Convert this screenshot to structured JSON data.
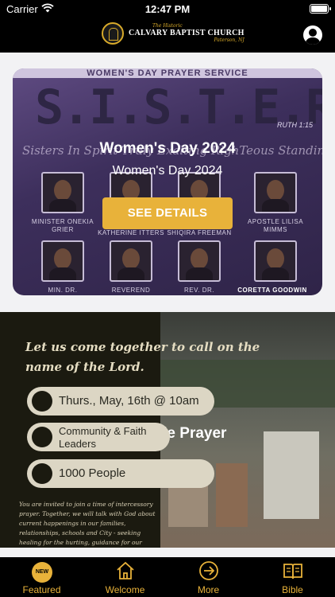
{
  "status_bar": {
    "carrier": "Carrier",
    "time": "12:47 PM"
  },
  "header": {
    "logo_small": "The Historic",
    "logo_name": "CALVARY BAPTIST CHURCH",
    "logo_location": "Paterson, NJ"
  },
  "featured_card": {
    "banner": "WOMEN'S DAY PRAYER SERVICE",
    "big_text": "S.I.S.T.E.R.S.",
    "ruth": "RUTH 1:15",
    "script": "Sisters In Spirit Truly Exalting RighTeous Standing",
    "title": "Women's Day 2024",
    "subtitle": "Women's Day 2024",
    "button_label": "SEE DETAILS",
    "names": [
      "MINISTER ONEKIA GRIER",
      "KATHERINE ITTERS",
      "SHIQIRA FREEMAN",
      "APOSTLE LILISA MIMMS",
      "MIN. DR.",
      "REVEREND",
      "REV. DR.",
      "CORETTA GOODWIN"
    ]
  },
  "prayer_card": {
    "tagline": "Let us come together to call on the name of the Lord.",
    "pill_1": "Thurs., May, 16th @ 10am",
    "pill_2": "Community & Faith Leaders",
    "pill_3": "1000 People",
    "invite": "You are invited to join a time of intercessory prayer. Together, we will talk with God about current happenings in our families, relationships, schools and City - seeking healing for the hurting, guidance for our",
    "title": "City-wide Prayer"
  },
  "tab_bar": {
    "badge": "NEW",
    "tabs": [
      "Featured",
      "Welcome",
      "More",
      "Bible"
    ]
  },
  "colors": {
    "accent": "#e8b23a",
    "bar_bg": "#000000"
  }
}
